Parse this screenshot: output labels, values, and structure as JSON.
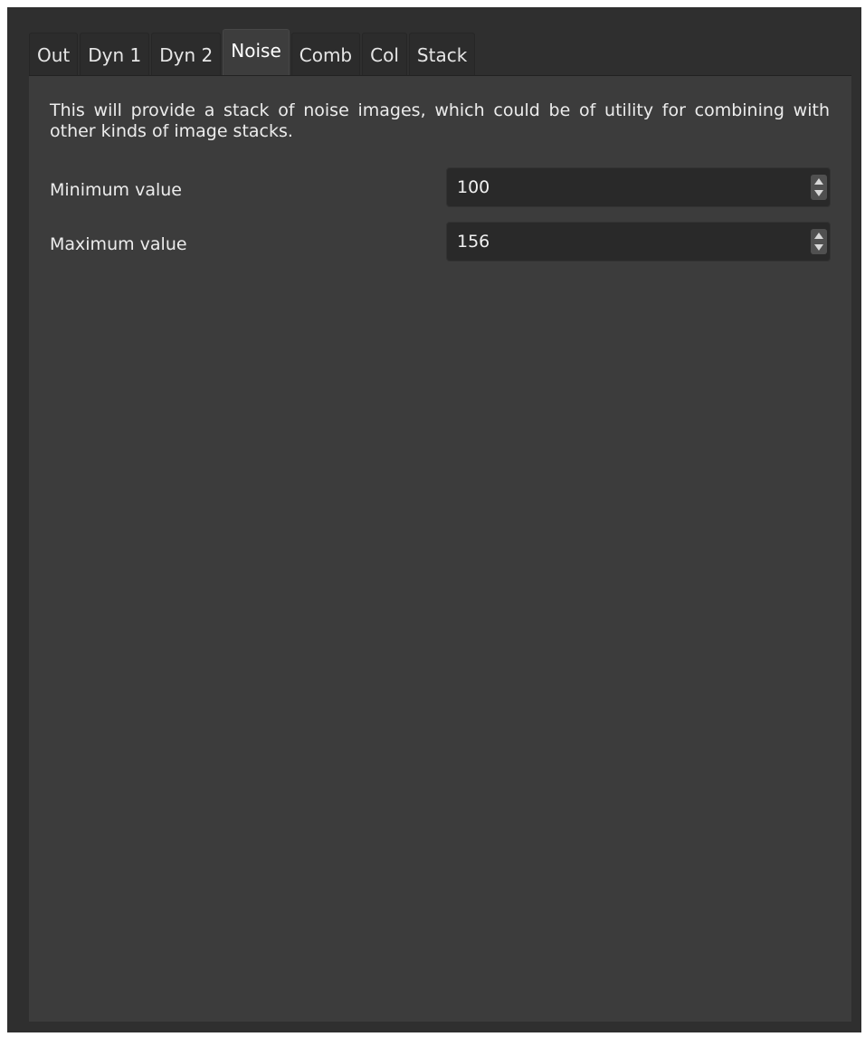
{
  "tabs": [
    {
      "label": "Out"
    },
    {
      "label": "Dyn 1"
    },
    {
      "label": "Dyn 2"
    },
    {
      "label": "Noise"
    },
    {
      "label": "Comb"
    },
    {
      "label": "Col"
    },
    {
      "label": "Stack"
    }
  ],
  "active_tab": "Noise",
  "noise": {
    "description": "This will provide a stack of noise images, which could be of utility for combining with other kinds of image stacks.",
    "minimum": {
      "label": "Minimum value",
      "value": "100"
    },
    "maximum": {
      "label": "Maximum value",
      "value": "156"
    }
  },
  "icons": {
    "spin_up": "chevron-up-icon",
    "spin_down": "chevron-down-icon"
  },
  "colors": {
    "window_bg": "#2f2f2f",
    "panel_bg": "#3c3c3c",
    "field_bg": "#292929",
    "text": "#ececec"
  }
}
